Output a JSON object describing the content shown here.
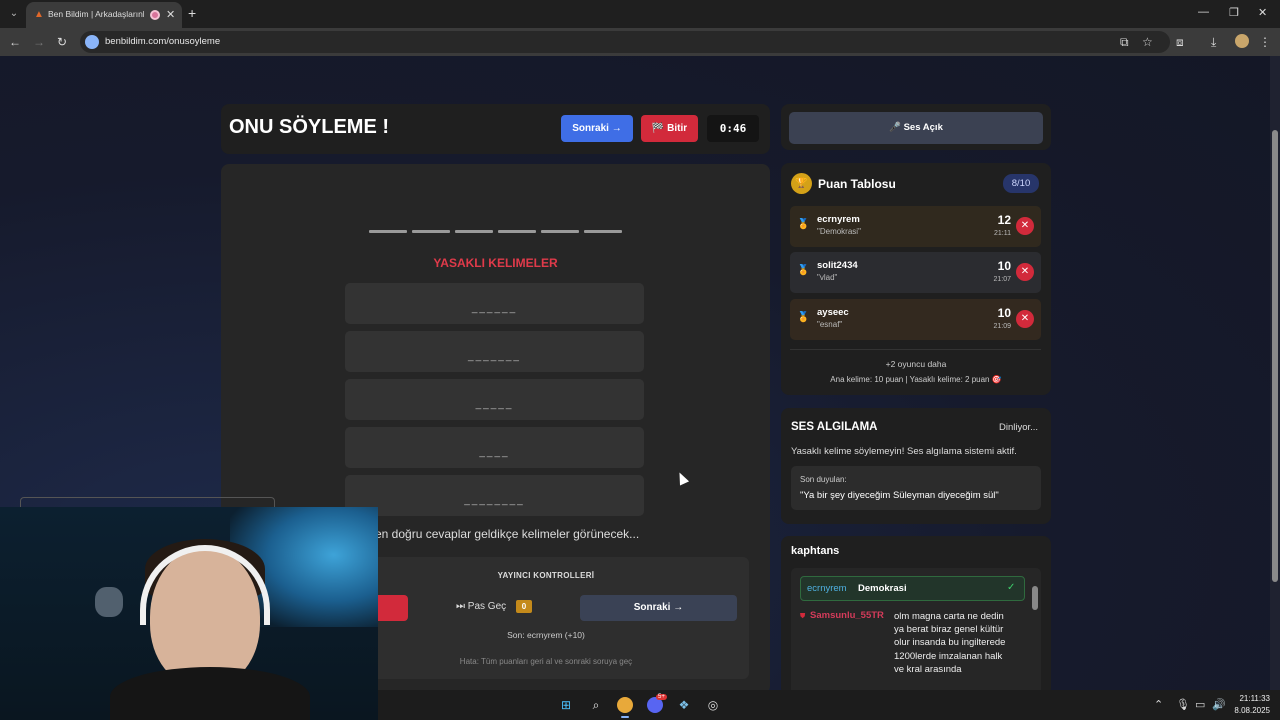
{
  "browser": {
    "tab_title": "Ben Bildim | Arkadaşlarınla",
    "url": "benbildim.com/onusoyleme"
  },
  "header": {
    "title": "ONU SÖYLEME !",
    "next_label": "Sonraki →",
    "finish_label": "Bitir",
    "timer": "0:46"
  },
  "game": {
    "forbidden_title": "YASAKLI KELIMELER",
    "forbidden_words": [
      "______",
      "_______",
      "_____",
      "____",
      "________"
    ],
    "hint": "en doğru cevaplar geldikçe kelimeler görünecek...",
    "controls": {
      "title": "YAYINCI KONTROLLERİ",
      "skip_label": "⏭ Pas Geç",
      "skip_count": "0",
      "next_label": "Sonraki →",
      "last": "Son: ecrnyrem (+10)",
      "error_info": "Hata: Tüm puanları geri al ve sonraki soruya geç"
    }
  },
  "sidebar": {
    "sound_label": "🎤 Ses Açık",
    "scoreboard": {
      "title": "Puan Tablosu",
      "round": "8/10",
      "players": [
        {
          "name": "ecrnyrem",
          "word": "\"Demokrasi\"",
          "score": "12",
          "time": "21:11",
          "medal_color": "#e09a2a"
        },
        {
          "name": "solit2434",
          "word": "\"vlad\"",
          "score": "10",
          "time": "21:07",
          "medal_color": "#b8c8e0"
        },
        {
          "name": "ayseec",
          "word": "\"esnaf\"",
          "score": "10",
          "time": "21:09",
          "medal_color": "#58b85a"
        }
      ],
      "more": "+2 oyuncu daha",
      "points_info": "Ana kelime: 10 puan | Yasaklı kelime: 2 puan 🎯"
    },
    "voice": {
      "title": "SES ALGILAMA",
      "status": "Dinliyor...",
      "message": "Yasaklı kelime söylemeyin! Ses algılama sistemi aktif.",
      "heard_label": "Son duyulan:",
      "heard_text": "\"Ya bir şey diyeceğim Süleyman diyeceğim sül\""
    },
    "chat": {
      "title": "kaphtans",
      "guess_user": "ecrnyrem",
      "guess_word": "Demokrasi",
      "msg_user": "Samsunlu_55TR",
      "msg_text": "olm magna carta ne dedin ya berat biraz genel kültür olur insanda bu ingilterede 1200lerde imzalanan halk ve kral arasında"
    }
  },
  "taskbar": {
    "time": "21:11:33",
    "date": "8.08.2025",
    "discord_badge": "5+"
  }
}
